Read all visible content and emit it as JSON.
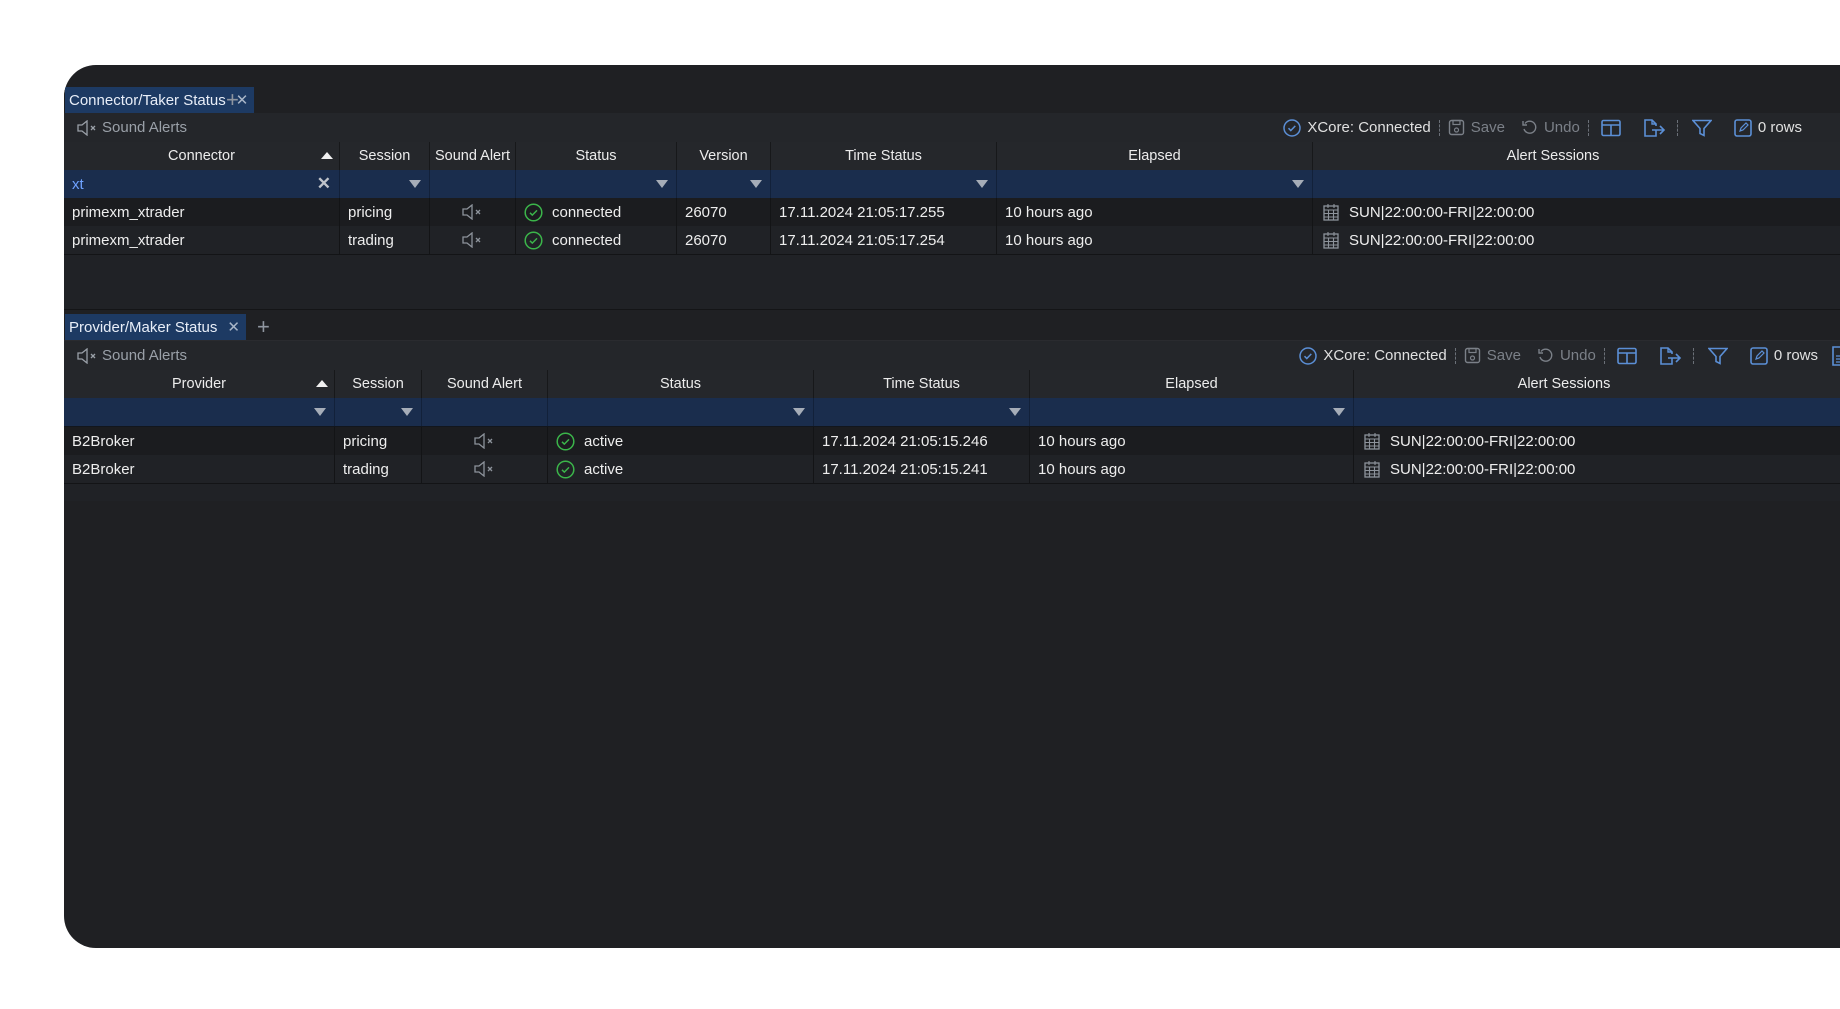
{
  "colors": {
    "window_bg": "#1f2023",
    "tab_active_bg": "#1d3a63",
    "filter_row_bg": "#1a2d4d",
    "filter_text": "#6fa2ff",
    "accent_blue": "#5b8fd6",
    "status_ok": "#3bb54a"
  },
  "panels": [
    {
      "tab": {
        "label": "Connector/Taker Status",
        "close": "✕",
        "add": "+"
      },
      "toolbar": {
        "sound_alerts": "Sound Alerts",
        "xcore_status": "XCore: Connected",
        "save": "Save",
        "undo": "Undo",
        "rows": "0 rows"
      },
      "columns": [
        "Connector",
        "Session",
        "Sound Alert",
        "Status",
        "Version",
        "Time Status",
        "Elapsed",
        "Alert Sessions"
      ],
      "filters": {
        "connector": "xt"
      },
      "rows": [
        {
          "name": "primexm_xtrader",
          "session": "pricing",
          "status": "connected",
          "version": "26070",
          "time_status": "17.11.2024 21:05:17.255",
          "elapsed": "10 hours ago",
          "alert_sessions": "SUN|22:00:00-FRI|22:00:00"
        },
        {
          "name": "primexm_xtrader",
          "session": "trading",
          "status": "connected",
          "version": "26070",
          "time_status": "17.11.2024 21:05:17.254",
          "elapsed": "10 hours ago",
          "alert_sessions": "SUN|22:00:00-FRI|22:00:00"
        }
      ]
    },
    {
      "tab": {
        "label": "Provider/Maker Status",
        "close": "✕",
        "add": "+"
      },
      "toolbar": {
        "sound_alerts": "Sound Alerts",
        "xcore_status": "XCore: Connected",
        "save": "Save",
        "undo": "Undo",
        "rows": "0 rows"
      },
      "columns": [
        "Provider",
        "Session",
        "Sound Alert",
        "Status",
        "Time Status",
        "Elapsed",
        "Alert Sessions"
      ],
      "filters": {},
      "rows": [
        {
          "name": "B2Broker",
          "session": "pricing",
          "status": "active",
          "time_status": "17.11.2024 21:05:15.246",
          "elapsed": "10 hours ago",
          "alert_sessions": "SUN|22:00:00-FRI|22:00:00"
        },
        {
          "name": "B2Broker",
          "session": "trading",
          "status": "active",
          "time_status": "17.11.2024 21:05:15.241",
          "elapsed": "10 hours ago",
          "alert_sessions": "SUN|22:00:00-FRI|22:00:00"
        }
      ]
    }
  ]
}
